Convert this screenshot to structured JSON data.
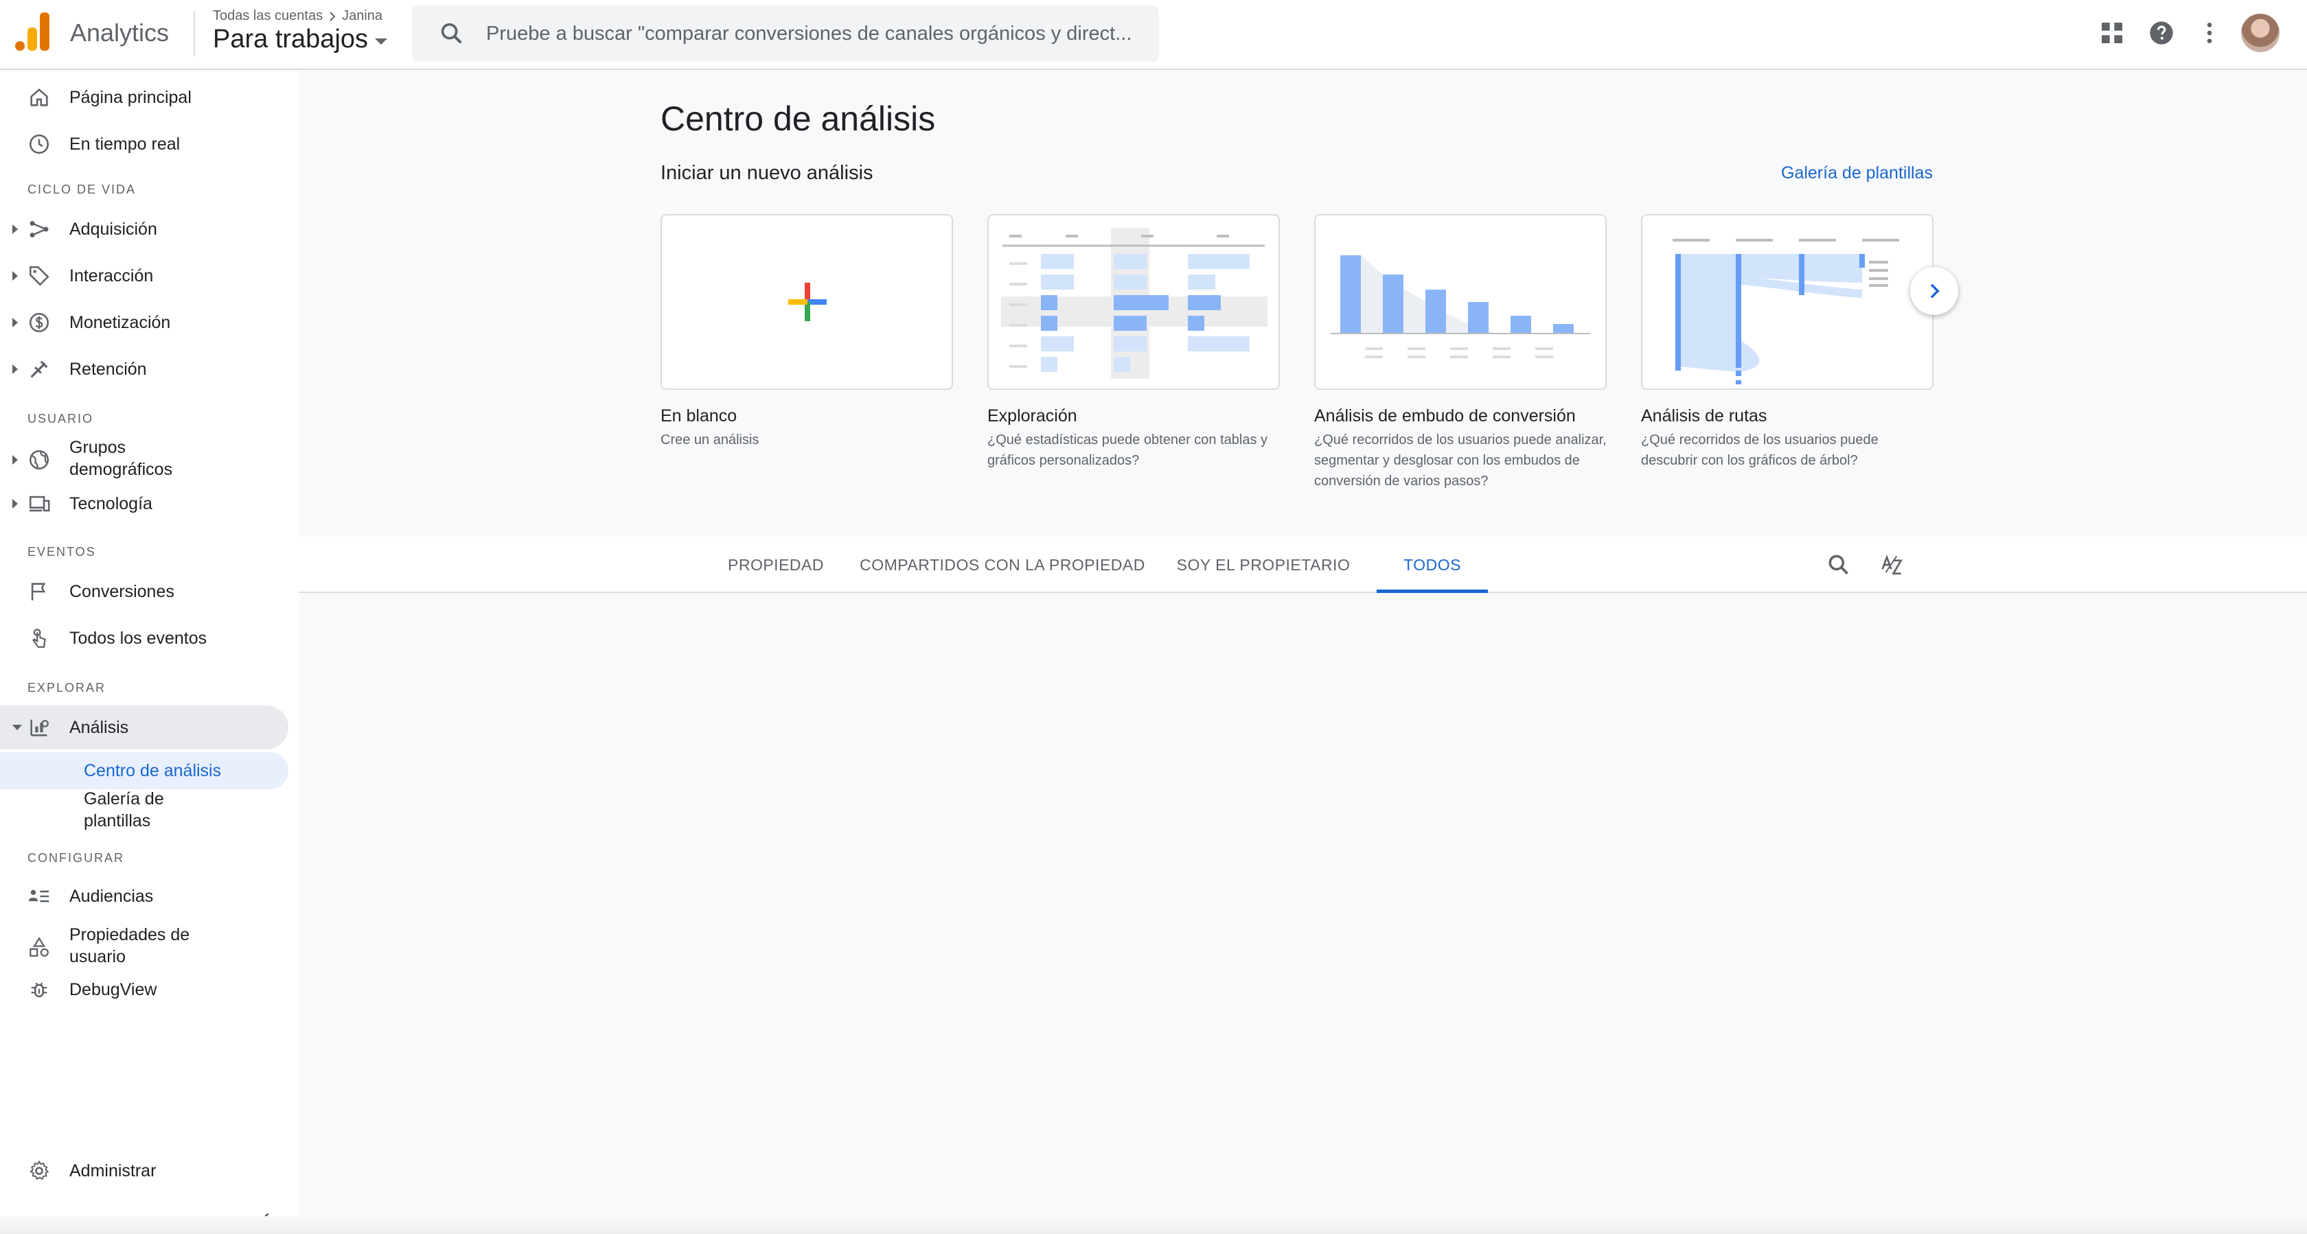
{
  "header": {
    "brand": "Analytics",
    "breadcrumb_account": "Todas las cuentas",
    "breadcrumb_user": "Janina",
    "property": "Para trabajos",
    "search_placeholder": "Pruebe a buscar \"comparar conversiones de canales orgánicos y direct..."
  },
  "sidebar": {
    "home": "Página principal",
    "realtime": "En tiempo real",
    "section_lifecycle": "CICLO DE VIDA",
    "acquisition": "Adquisición",
    "engagement": "Interacción",
    "monetization": "Monetización",
    "retention": "Retención",
    "section_user": "USUARIO",
    "demographics_1": "Grupos",
    "demographics_2": "demográficos",
    "tech": "Tecnología",
    "section_events": "EVENTOS",
    "conversions": "Conversiones",
    "all_events": "Todos los eventos",
    "section_explore": "EXPLORAR",
    "analysis": "Análisis",
    "analysis_hub": "Centro de análisis",
    "template_gallery_1": "Galería de",
    "template_gallery_2": "plantillas",
    "section_configure": "CONFIGURAR",
    "audiences": "Audiencias",
    "user_props_1": "Propiedades de",
    "user_props_2": "usuario",
    "debugview": "DebugView",
    "admin": "Administrar"
  },
  "main": {
    "title": "Centro de análisis",
    "subtitle": "Iniciar un nuevo análisis",
    "gallery_link": "Galería de plantillas",
    "cards": [
      {
        "name": "En blanco",
        "desc": "Cree un análisis"
      },
      {
        "name": "Exploración",
        "desc": "¿Qué estadísticas puede obtener con tablas y gráficos personalizados?"
      },
      {
        "name": "Análisis de embudo de conversión",
        "desc": "¿Qué recorridos de los usuarios puede analizar, segmentar y desglosar con los embudos de conversión de varios pasos?"
      },
      {
        "name": "Análisis de rutas",
        "desc": "¿Qué recorridos de los usuarios puede descubrir con los gráficos de árbol?"
      }
    ],
    "tabs": [
      "PROPIEDAD",
      "COMPARTIDOS CON LA PROPIEDAD",
      "SOY EL PROPIETARIO",
      "TODOS"
    ],
    "active_tab": "TODOS"
  },
  "colors": {
    "accent": "#1967d2",
    "logo_orange": "#f9ab00",
    "logo_dark": "#e37400",
    "chart_blue": "#8ab4f8"
  }
}
